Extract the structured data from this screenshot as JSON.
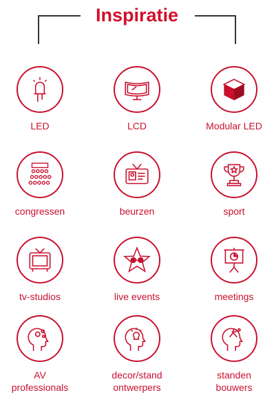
{
  "title": "Inspiratie",
  "accent_color": "#c8102e",
  "items": [
    {
      "label": "LED",
      "icon": "led-bulb-icon"
    },
    {
      "label": "LCD",
      "icon": "curved-screen-icon"
    },
    {
      "label": "Modular LED",
      "icon": "cube-icon"
    },
    {
      "label": "congressen",
      "icon": "audience-icon"
    },
    {
      "label": "beurzen",
      "icon": "id-badge-icon"
    },
    {
      "label": "sport",
      "icon": "trophy-icon"
    },
    {
      "label": "tv-studios",
      "icon": "tv-icon"
    },
    {
      "label": "live events",
      "icon": "star-glasses-icon"
    },
    {
      "label": "meetings",
      "icon": "presentation-board-icon"
    },
    {
      "label": "AV\nprofessionals",
      "icon": "head-gears-icon"
    },
    {
      "label": "decor/stand\nontwerpers",
      "icon": "head-idea-icon"
    },
    {
      "label": "standen\nbouwers",
      "icon": "head-tools-icon"
    }
  ]
}
